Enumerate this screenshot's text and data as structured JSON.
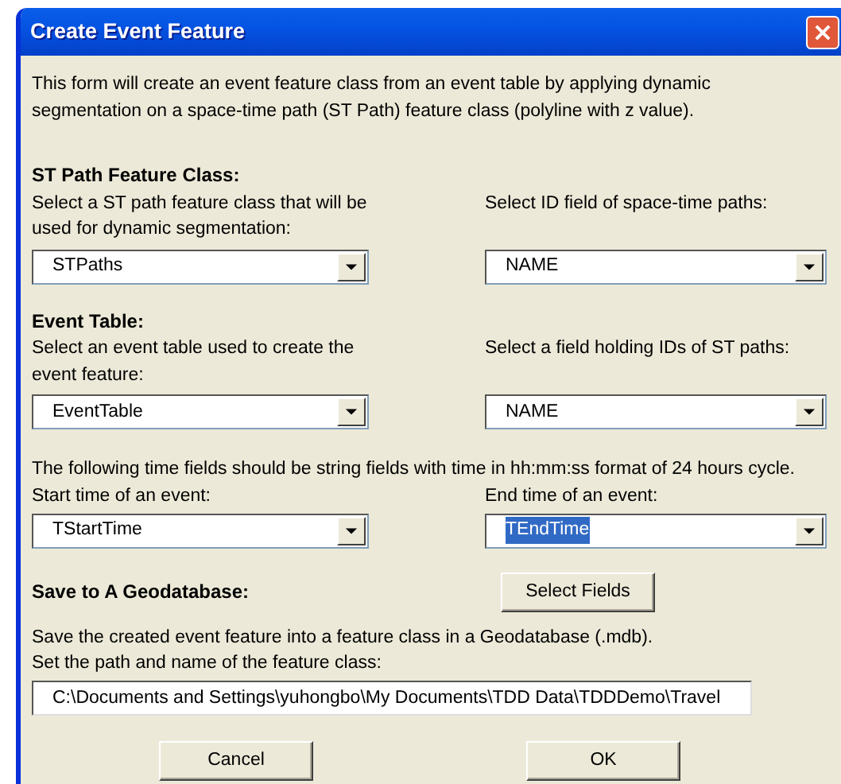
{
  "window": {
    "title": "Create Event Feature"
  },
  "intro": "This form will create an event feature class from an event table by applying dynamic segmentation on a space-time path (ST Path) feature class (polyline with z value).",
  "st_path_section": {
    "heading": "ST Path Feature Class:",
    "fields": [
      {
        "label": "Select a ST path feature class that will be used for dynamic segmentation:",
        "value": "STPaths",
        "highlighted": false
      },
      {
        "label": "Select ID field of space-time paths:",
        "value": "NAME",
        "highlighted": false
      }
    ]
  },
  "event_section": {
    "heading": "Event Table:",
    "fields": [
      {
        "label": "Select an event table used to create the event feature:",
        "value": "EventTable",
        "highlighted": false
      },
      {
        "label": "Select a field holding IDs of ST paths:",
        "value": "NAME",
        "highlighted": false
      }
    ]
  },
  "time_section": {
    "note": "The following time fields should be string fields with time in hh:mm:ss format of 24 hours cycle.",
    "fields": [
      {
        "label": "Start time of an event:",
        "value": "TStartTime",
        "highlighted": false
      },
      {
        "label": "End time of an event:",
        "value": "TEndTime",
        "highlighted": true
      }
    ]
  },
  "save_section": {
    "heading": "Save to A Geodatabase:",
    "select_fields_button": "Select Fields",
    "description": "Save the created event feature into a feature class in a Geodatabase (.mdb).",
    "path_label": "Set the path and name of the feature class:",
    "path_value": "C:\\Documents and Settings\\yuhongbo\\My Documents\\TDD Data\\TDDDemo\\Travel"
  },
  "buttons": [
    "Cancel",
    "OK"
  ]
}
